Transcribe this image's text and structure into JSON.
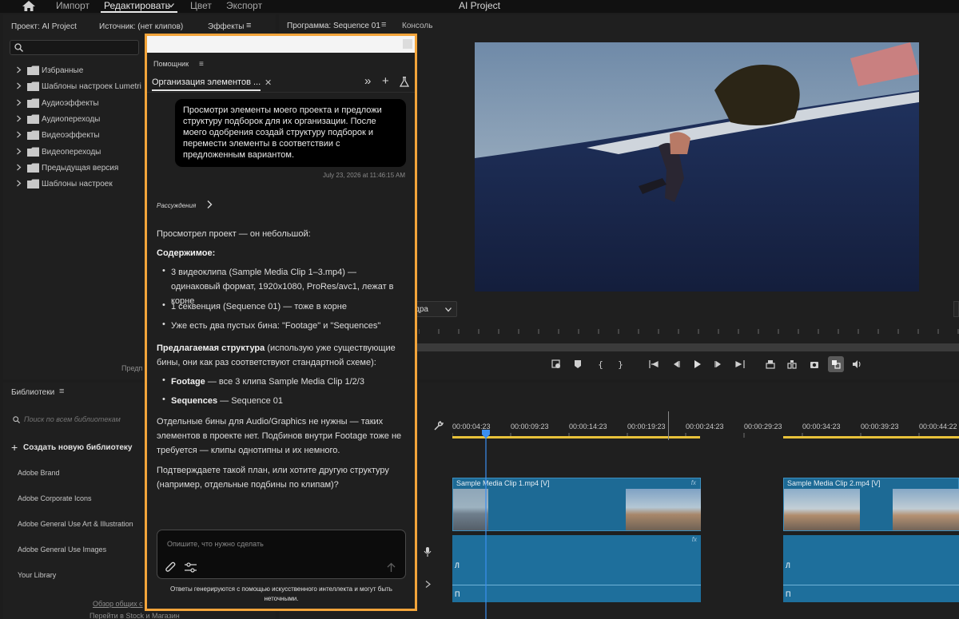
{
  "topbar": {
    "tabs": [
      "Импорт",
      "Редактировать",
      "Цвет",
      "Экспорт"
    ],
    "app_title": "AI Project"
  },
  "project_panel": {
    "tabs": [
      "Проект: AI Project",
      "Источник: (нет клипов)",
      "Эффекты"
    ],
    "tree_items": [
      "Избранные",
      "Шаблоны настроек Lumetri",
      "Аудиоэффекты",
      "Аудиопереходы",
      "Видеоэффекты",
      "Видеопереходы",
      "Предыдущая версия",
      "Шаблоны настроек"
    ],
    "footer_text": "Предп"
  },
  "libraries_panel": {
    "title": "Библиотеки",
    "search_placeholder": "Поиск по всем библиотекам",
    "create_label": "Создать новую библиотеку",
    "items": [
      "Adobe Brand",
      "Adobe Corporate Icons",
      "Adobe General Use Art & Illustration",
      "Adobe General Use Images",
      "Your Library"
    ],
    "footer_links": [
      "Обзор общих с",
      "Перейти в Stock и Магазин"
    ]
  },
  "program_panel": {
    "tabs": [
      "Программа: Sequence 01",
      "Консоль"
    ],
    "fit_dropdown": "дра"
  },
  "timeline": {
    "ruler": [
      "00:00:04:23",
      "00:00:09:23",
      "00:00:14:23",
      "00:00:19:23",
      "00:00:24:23",
      "00:00:29:23",
      "00:00:34:23",
      "00:00:39:23",
      "00:00:44:22"
    ],
    "clips": [
      "Sample Media Clip 1.mp4 [V]",
      "Sample Media Clip 2.mp4 [V]"
    ],
    "fx_label": "fx",
    "channel_left": "Л",
    "channel_right": "П"
  },
  "assistant": {
    "panel_title": "Помощник",
    "chat_tab": "Организация элементов ...",
    "user_message": "Просмотри элементы моего проекта и предложи структуру подборок для их организации. После моего одобрения создай структуру подборок и перемести элементы в соответствии с предложенным вариантом.",
    "timestamp": "July 23, 2026 at 11:46:15 AM",
    "reasoning": "Рассуждения",
    "response": {
      "intro": "Просмотрел проект — он небольшой:",
      "contents_heading": "Содержимое:",
      "contents": [
        "3 видеоклипа (Sample Media Clip 1–3.mp4) — одинаковый формат, 1920x1080, ProRes/avc1, лежат в корне",
        "1 секвенция (Sequence 01) — тоже в корне",
        "Уже есть два пустых бина: \"Footage\" и \"Sequences\""
      ],
      "structure_heading": "Предлагаемая структура",
      "structure_note": " (использую уже существующие бины, они как раз соответствуют стандартной схеме):",
      "structure": [
        {
          "name": "Footage",
          "desc": " — все 3 клипа Sample Media Clip 1/2/3"
        },
        {
          "name": "Sequences",
          "desc": " — Sequence 01"
        }
      ],
      "note": "Отдельные бины для Audio/Graphics не нужны — таких элементов в проекте нет. Подбинов внутри Footage тоже не требуется — клипы однотипны и их немного.",
      "question": "Подтверждаете такой план, или хотите другую структуру (например, отдельные подбины по клипам)?"
    },
    "input_placeholder": "Опишите, что нужно сделать",
    "disclaimer": "Ответы генерируются с помощью искусственного интеллекта и могут быть неточными."
  },
  "colors": {
    "accent_outline": "#f2a43a",
    "clip_blue": "#1d6a95",
    "playhead": "#3b8ff0",
    "work_area": "#e8c23a"
  }
}
